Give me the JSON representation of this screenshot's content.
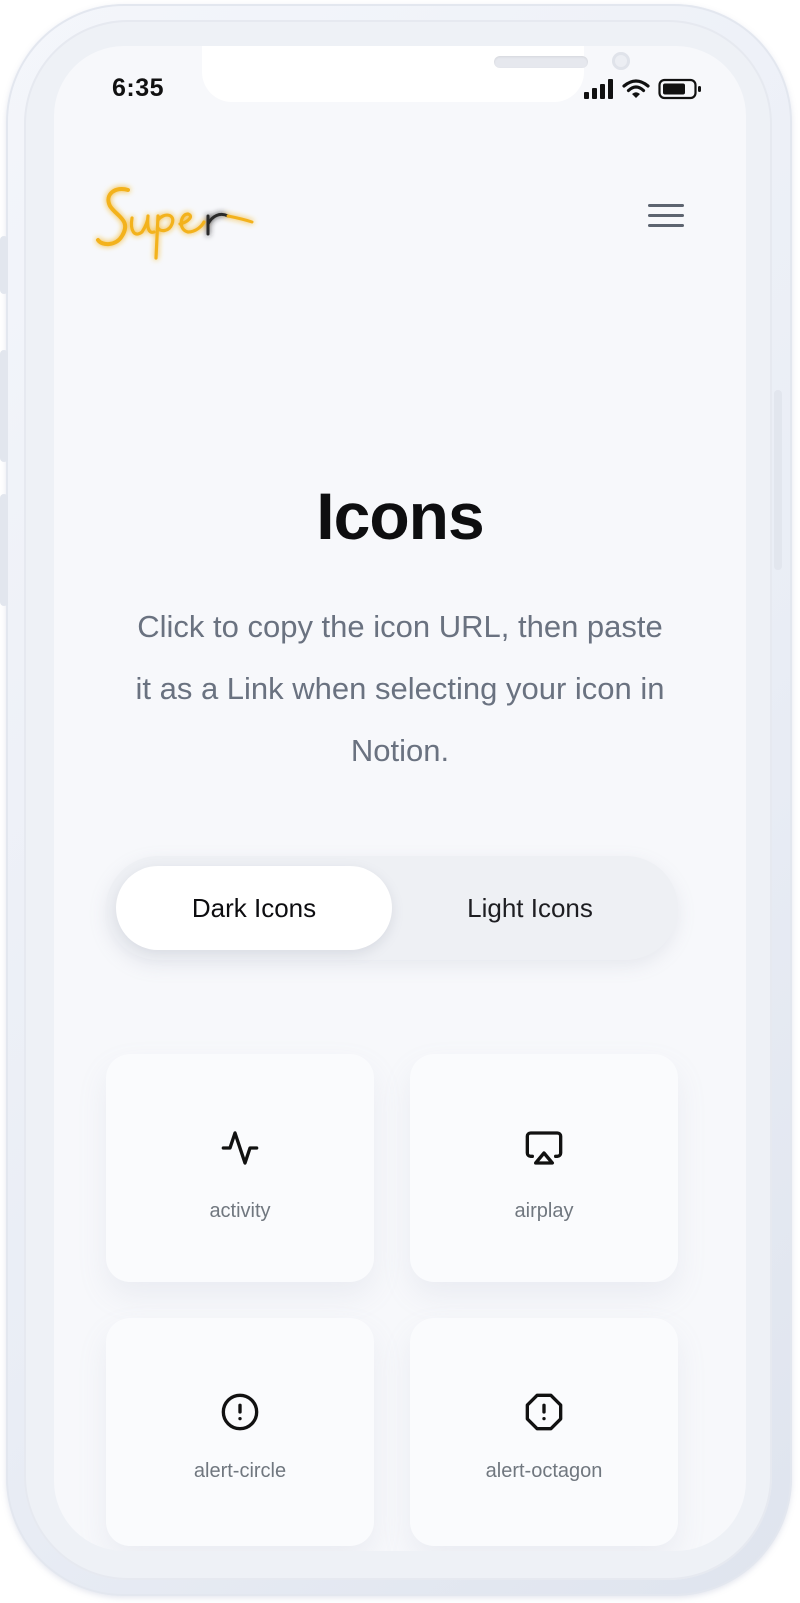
{
  "status_bar": {
    "time": "6:35"
  },
  "header": {
    "logo_text": "Super"
  },
  "hero": {
    "title": "Icons",
    "description": "Click to copy the icon URL, then paste it as a Link when selecting your icon in Notion."
  },
  "toggle": {
    "options": [
      "Dark Icons",
      "Light Icons"
    ],
    "selected": "Dark Icons"
  },
  "icons": [
    {
      "name": "activity",
      "icon": "activity-icon"
    },
    {
      "name": "airplay",
      "icon": "airplay-icon"
    },
    {
      "name": "alert-circle",
      "icon": "alert-circle-icon"
    },
    {
      "name": "alert-octagon",
      "icon": "alert-octagon-icon"
    }
  ],
  "colors": {
    "background": "#f7f8fb",
    "title": "#0e0e10",
    "description": "#6a7280",
    "logo_gold": "#f3b21e",
    "logo_dark": "#2a2a2a"
  }
}
